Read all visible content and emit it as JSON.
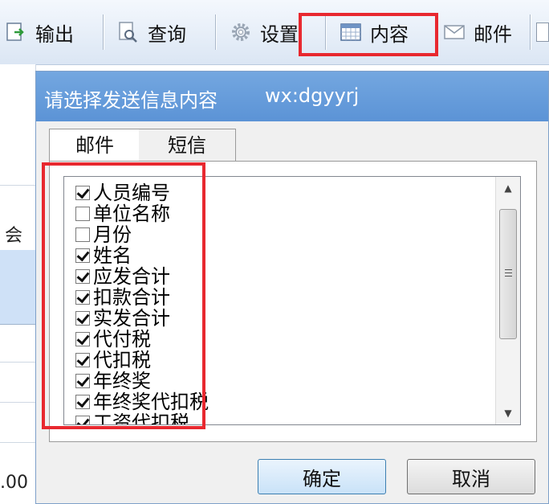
{
  "toolbar": {
    "items": [
      {
        "label": "输出",
        "icon": "export-icon"
      },
      {
        "label": "查询",
        "icon": "magnifier-doc-icon"
      },
      {
        "label": "设置",
        "icon": "gear-icon"
      },
      {
        "label": "内容",
        "icon": "table-icon"
      },
      {
        "label": "邮件",
        "icon": "envelope-icon"
      }
    ]
  },
  "background": {
    "column_header": "会",
    "cell_value": ".00"
  },
  "dialog": {
    "title": "请选择发送信息内容",
    "watermark": "wx:dgyyrj",
    "tabs": [
      "邮件",
      "短信"
    ],
    "fields": [
      {
        "label": "人员编号",
        "checked": true
      },
      {
        "label": "单位名称",
        "checked": false
      },
      {
        "label": "月份",
        "checked": false
      },
      {
        "label": "姓名",
        "checked": true
      },
      {
        "label": "应发合计",
        "checked": true
      },
      {
        "label": "扣款合计",
        "checked": true
      },
      {
        "label": "实发合计",
        "checked": true
      },
      {
        "label": "代付税",
        "checked": true
      },
      {
        "label": "代扣税",
        "checked": true
      },
      {
        "label": "年终奖",
        "checked": true
      },
      {
        "label": "年终奖代扣税",
        "checked": true
      },
      {
        "label": "工资代扣税",
        "checked": true
      }
    ],
    "ok_label": "确定",
    "cancel_label": "取消"
  },
  "colors": {
    "highlight_red": "#e8282f",
    "title_blue": "#5b93d6"
  }
}
